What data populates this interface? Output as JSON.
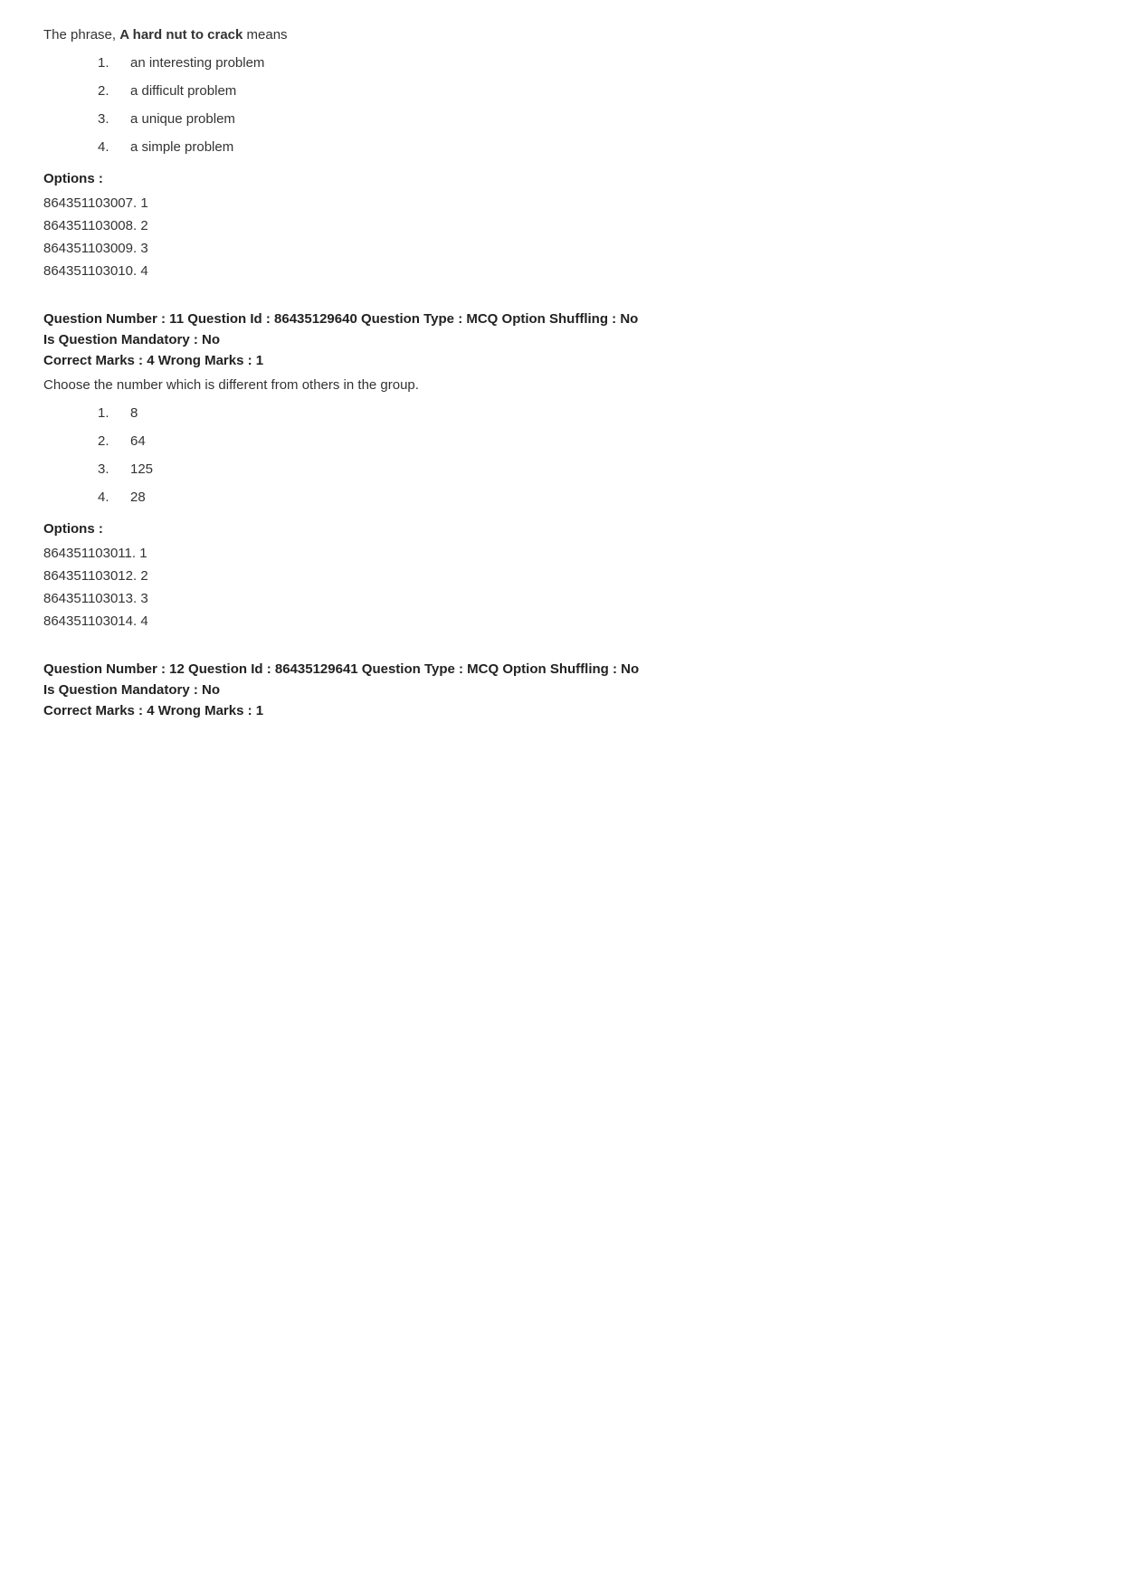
{
  "section_prev": {
    "phrase_text_before": "The phrase, ",
    "phrase_bold": "A hard nut to crack",
    "phrase_text_after": " means",
    "choices": [
      {
        "num": "1.",
        "text": "an interesting problem"
      },
      {
        "num": "2.",
        "text": "a difficult problem"
      },
      {
        "num": "3.",
        "text": "a unique problem"
      },
      {
        "num": "4.",
        "text": "a simple problem"
      }
    ],
    "options_label": "Options :",
    "option_ids": [
      "864351103007. 1",
      "864351103008. 2",
      "864351103009. 3",
      "864351103010. 4"
    ]
  },
  "question11": {
    "meta": "Question Number : 11 Question Id : 86435129640 Question Type : MCQ Option Shuffling : No",
    "mandatory": "Is Question Mandatory : No",
    "marks": "Correct Marks : 4 Wrong Marks : 1",
    "question_text": "Choose the number which is different from others in the group.",
    "choices": [
      {
        "num": "1.",
        "text": "8"
      },
      {
        "num": "2.",
        "text": "64"
      },
      {
        "num": "3.",
        "text": "125"
      },
      {
        "num": "4.",
        "text": "28"
      }
    ],
    "options_label": "Options :",
    "option_ids": [
      "864351103011. 1",
      "864351103012. 2",
      "864351103013. 3",
      "864351103014. 4"
    ]
  },
  "question12": {
    "meta": "Question Number : 12 Question Id : 86435129641 Question Type : MCQ Option Shuffling : No",
    "mandatory": "Is Question Mandatory : No",
    "marks": "Correct Marks : 4 Wrong Marks : 1"
  }
}
